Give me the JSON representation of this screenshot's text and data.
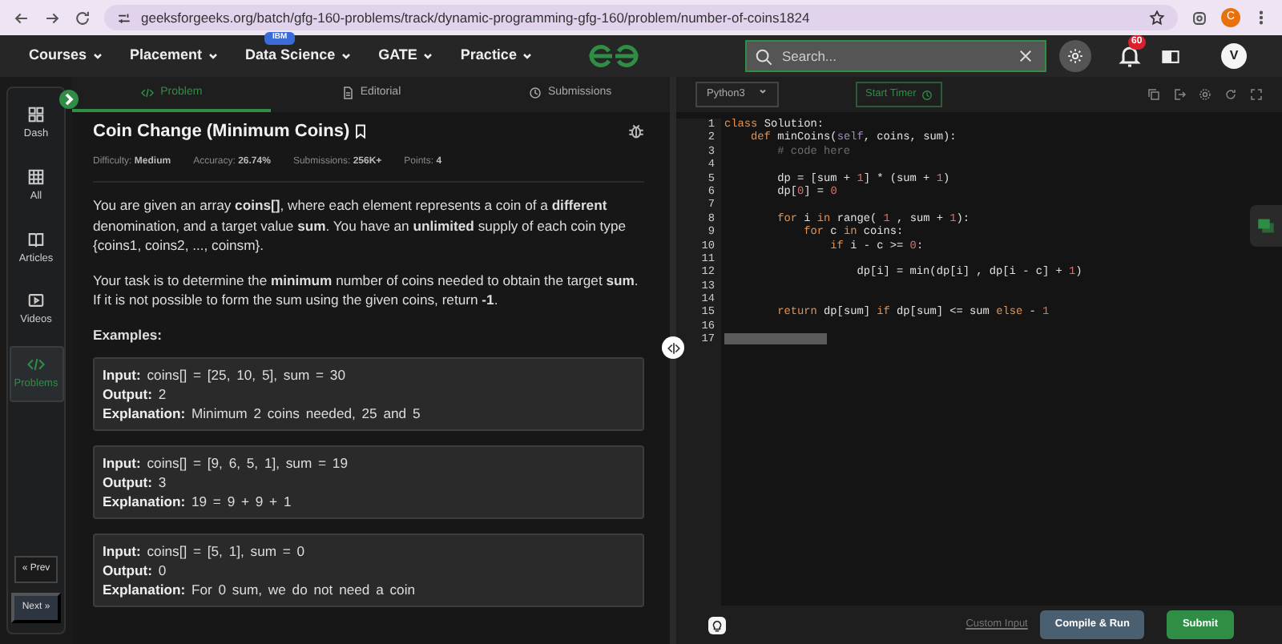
{
  "browser": {
    "url": "geeksforgeeks.org/batch/gfg-160-problems/track/dynamic-programming-gfg-160/problem/number-of-coins1824",
    "profile": "C"
  },
  "nav": {
    "menus": [
      {
        "label": "Courses"
      },
      {
        "label": "Placement"
      },
      {
        "label": "Data Science",
        "badge": "IBM"
      },
      {
        "label": "GATE"
      },
      {
        "label": "Practice"
      }
    ],
    "search": {
      "placeholder": "Search..."
    },
    "notifications": "60",
    "avatar": "V"
  },
  "sidebar": {
    "items": [
      {
        "label": "Dash",
        "selected": false
      },
      {
        "label": "All",
        "selected": false
      },
      {
        "label": "Articles",
        "selected": false
      },
      {
        "label": "Videos",
        "selected": false
      },
      {
        "label": "Problems",
        "selected": true
      }
    ],
    "prev": "« Prev",
    "next": "Next »"
  },
  "tabs": [
    {
      "label": "Problem",
      "selected": true
    },
    {
      "label": "Editorial",
      "selected": false
    },
    {
      "label": "Submissions",
      "selected": false
    }
  ],
  "problem": {
    "title": "Coin Change (Minimum Coins)",
    "meta": [
      {
        "label": "Difficulty:",
        "value": "Medium"
      },
      {
        "label": "Accuracy:",
        "value": "26.74%"
      },
      {
        "label": "Submissions:",
        "value": "256K+"
      },
      {
        "label": "Points:",
        "value": "4"
      }
    ],
    "paragraphs": [
      "You are given an array **coins[]**, where each element represents a coin of a **different** denomination, and a target value **sum**. You have an **unlimited** supply of each coin type {coins1, coins2, ..., coinsm}.",
      "Your task is to determine the **minimum** number of coins needed to obtain the target **sum**. If it is not possible to form the sum using the given coins, return **-1**."
    ],
    "examples_heading": "Examples:",
    "examples": [
      {
        "lines": [
          {
            "label": "Input:",
            "text": "coins[] = [25, 10, 5], sum = 30"
          },
          {
            "label": "Output:",
            "text": "2"
          },
          {
            "label": "Explanation:",
            "text": "Minimum 2 coins needed, 25 and 5"
          }
        ]
      },
      {
        "lines": [
          {
            "label": "Input:",
            "text": "coins[] = [9, 6, 5, 1], sum = 19"
          },
          {
            "label": "Output:",
            "text": "3"
          },
          {
            "label": "Explanation:",
            "text": "19 = 9 + 9 + 1"
          }
        ]
      },
      {
        "lines": [
          {
            "label": "Input:",
            "text": "coins[] = [5, 1], sum = 0"
          },
          {
            "label": "Output:",
            "text": "0"
          },
          {
            "label": "Explanation:",
            "text": "For 0 sum, we do not need a coin"
          }
        ]
      }
    ]
  },
  "editor": {
    "language": "Python3",
    "timer": "Start Timer",
    "lines": [
      {
        "number": "1",
        "code": [
          {
            "text": "class",
            "kind": "keyword"
          },
          {
            "text": " Solution:",
            "kind": "plain"
          }
        ]
      },
      {
        "number": "2",
        "code": [
          {
            "text": "    def",
            "kind": "keyword"
          },
          {
            "text": " minCoins(",
            "kind": "plain"
          },
          {
            "text": "self",
            "kind": "param"
          },
          {
            "text": ", coins, sum):",
            "kind": "plain"
          }
        ]
      },
      {
        "number": "3",
        "code": [
          {
            "text": "        # code here",
            "kind": "comment"
          }
        ]
      },
      {
        "number": "4"
      },
      {
        "number": "5",
        "code": [
          {
            "text": "        dp = [sum + ",
            "kind": "plain"
          },
          {
            "text": "1",
            "kind": "number"
          },
          {
            "text": "] * (sum + ",
            "kind": "plain"
          },
          {
            "text": "1",
            "kind": "number"
          },
          {
            "text": ")",
            "kind": "plain"
          }
        ]
      },
      {
        "number": "6",
        "code": [
          {
            "text": "        dp[",
            "kind": "plain"
          },
          {
            "text": "0",
            "kind": "number"
          },
          {
            "text": "] = ",
            "kind": "plain"
          },
          {
            "text": "0",
            "kind": "number"
          }
        ]
      },
      {
        "number": "7"
      },
      {
        "number": "8",
        "code": [
          {
            "text": "        for",
            "kind": "keyword"
          },
          {
            "text": " i ",
            "kind": "plain"
          },
          {
            "text": "in",
            "kind": "keyword"
          },
          {
            "text": " range( ",
            "kind": "plain"
          },
          {
            "text": "1",
            "kind": "number"
          },
          {
            "text": " , sum + ",
            "kind": "plain"
          },
          {
            "text": "1",
            "kind": "number"
          },
          {
            "text": "):",
            "kind": "plain"
          }
        ]
      },
      {
        "number": "9",
        "code": [
          {
            "text": "            for",
            "kind": "keyword"
          },
          {
            "text": " c ",
            "kind": "plain"
          },
          {
            "text": "in",
            "kind": "keyword"
          },
          {
            "text": " coins:",
            "kind": "plain"
          }
        ]
      },
      {
        "number": "10",
        "code": [
          {
            "text": "                if",
            "kind": "keyword"
          },
          {
            "text": " i - c >= ",
            "kind": "plain"
          },
          {
            "text": "0",
            "kind": "number"
          },
          {
            "text": ":",
            "kind": "plain"
          }
        ]
      },
      {
        "number": "11"
      },
      {
        "number": "12",
        "code": [
          {
            "text": "                    dp[i] = min(dp[i] , dp[i - c] + ",
            "kind": "plain"
          },
          {
            "text": "1",
            "kind": "number"
          },
          {
            "text": ")",
            "kind": "plain"
          }
        ]
      },
      {
        "number": "13"
      },
      {
        "number": "14"
      },
      {
        "number": "15",
        "code": [
          {
            "text": "        return",
            "kind": "keyword"
          },
          {
            "text": " dp[sum] ",
            "kind": "plain"
          },
          {
            "text": "if",
            "kind": "keyword"
          },
          {
            "text": " dp[sum] <= sum ",
            "kind": "plain"
          },
          {
            "text": "else",
            "kind": "keyword"
          },
          {
            "text": " - ",
            "kind": "plain"
          },
          {
            "text": "1",
            "kind": "number"
          }
        ]
      },
      {
        "number": "16"
      },
      {
        "number": "17",
        "selected": true
      }
    ],
    "custom_input": "Custom Input",
    "compile": "Compile & Run",
    "submit": "Submit"
  }
}
